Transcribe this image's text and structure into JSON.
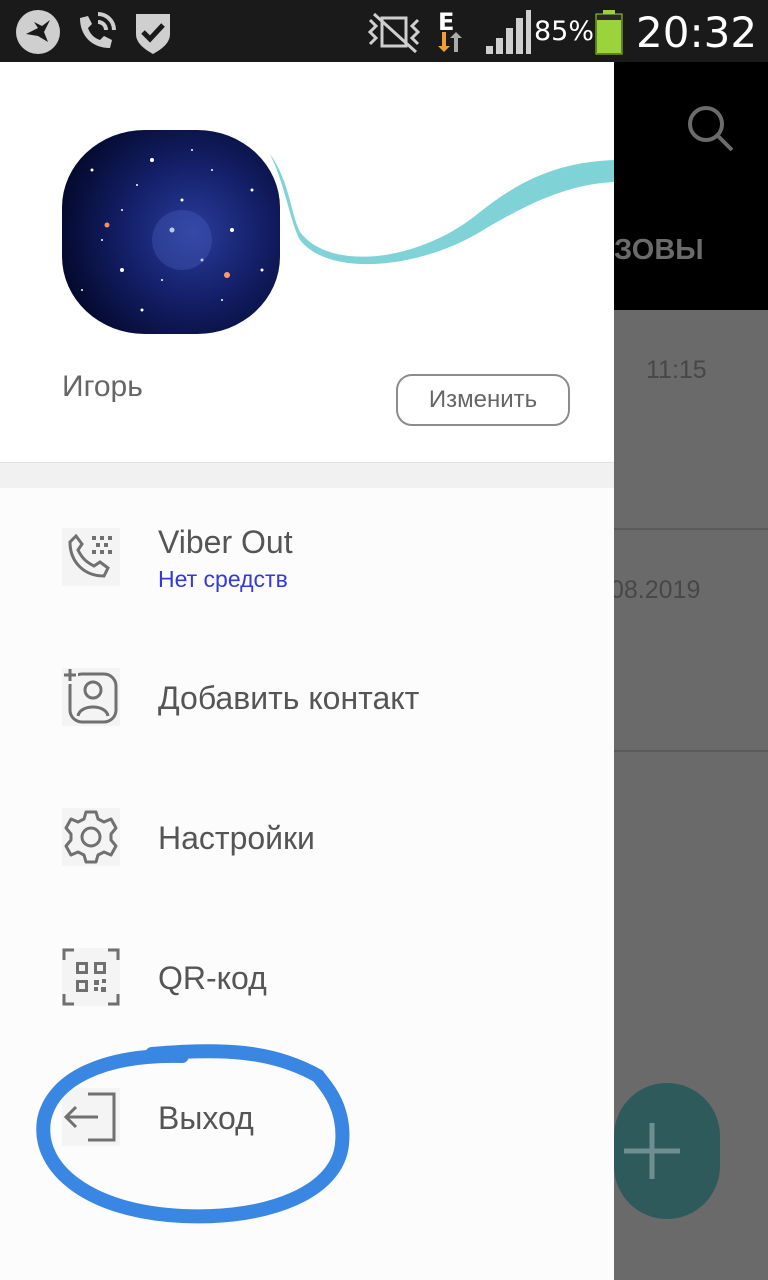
{
  "status_bar": {
    "battery_percent": "85%",
    "time": "20:32",
    "network_type": "E",
    "icons": [
      "bird-notification-icon",
      "wifi-call-icon",
      "shield-check-icon",
      "vibrate-mute-icon",
      "data-arrows-icon",
      "signal-icon",
      "battery-icon"
    ]
  },
  "background_app": {
    "tab_label": "ЗОВЫ",
    "items": [
      {
        "time": "11:15"
      },
      {
        "time": "08.2019"
      }
    ],
    "search_icon": "search-icon",
    "fab_icon": "plus-icon"
  },
  "drawer": {
    "profile": {
      "name": "Игорь",
      "edit_label": "Изменить"
    },
    "menu": [
      {
        "label": "Viber Out",
        "sublabel": "Нет средств",
        "icon": "viber-out-phone-icon"
      },
      {
        "label": "Добавить контакт",
        "icon": "add-contact-icon"
      },
      {
        "label": "Настройки",
        "icon": "gear-icon"
      },
      {
        "label": "QR-код",
        "icon": "qr-code-icon"
      },
      {
        "label": "Выход",
        "icon": "exit-icon"
      }
    ]
  },
  "colors": {
    "accent_sublabel": "#3539d8",
    "wave": "#7fd3d6",
    "annotation_circle": "#3a86e3",
    "status_bar": "#1a1a1a"
  }
}
